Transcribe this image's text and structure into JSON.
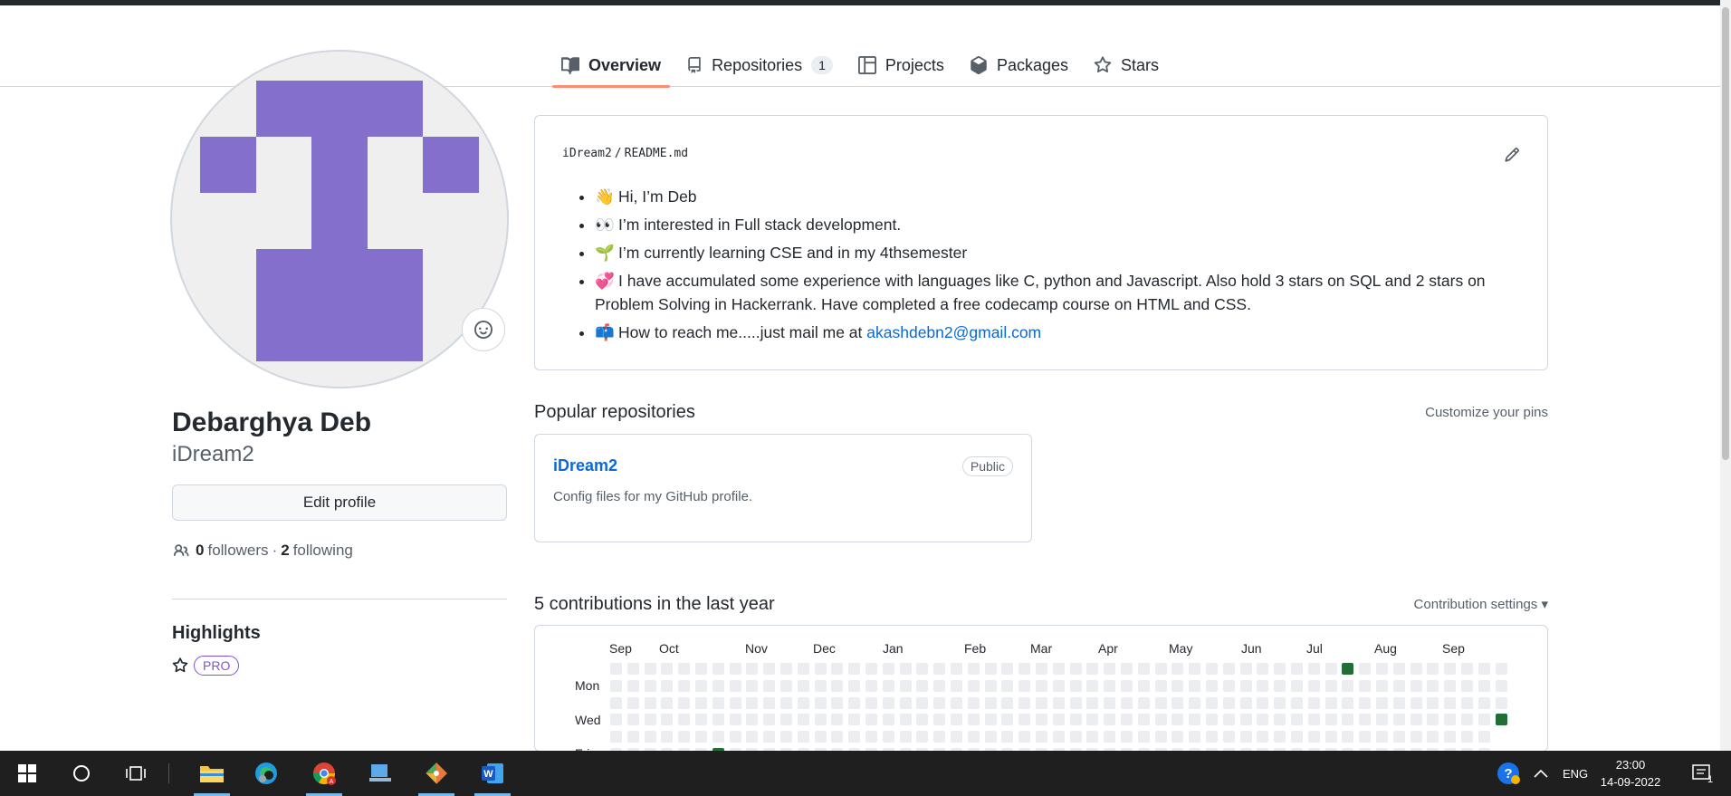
{
  "tabs": [
    {
      "label": "Overview",
      "icon": "book-icon"
    },
    {
      "label": "Repositories",
      "icon": "repo-icon",
      "count": "1"
    },
    {
      "label": "Projects",
      "icon": "table-icon"
    },
    {
      "label": "Packages",
      "icon": "package-icon"
    },
    {
      "label": "Stars",
      "icon": "star-icon"
    }
  ],
  "profile": {
    "name": "Debarghya Deb",
    "login": "iDream2",
    "edit_label": "Edit profile",
    "followers_count": "0",
    "followers_label": "followers",
    "separator": "·",
    "following_count": "2",
    "following_label": "following",
    "highlights_title": "Highlights",
    "pro_badge": "PRO"
  },
  "readme": {
    "owner": "iDream2",
    "slash": "/",
    "file": "README.md",
    "items": [
      {
        "emoji": "👋",
        "text": "Hi, I’m Deb"
      },
      {
        "emoji": "👀",
        "text": "I’m interested in Full stack development."
      },
      {
        "emoji": "🌱",
        "text": "I’m currently learning CSE and in my 4thsemester"
      },
      {
        "emoji": "💞️",
        "text": "I have accumulated some experience with languages like C, python and Javascript. Also hold 3 stars on SQL and 2 stars on Problem Solving in Hackerrank. Have completed a free codecamp course on HTML and CSS."
      },
      {
        "emoji": "📫",
        "text": "How to reach me.....just mail me at ",
        "link": "akashdebn2@gmail.com"
      }
    ]
  },
  "popular": {
    "title": "Popular repositories",
    "customize": "Customize your pins",
    "repo": {
      "name": "iDream2",
      "visibility": "Public",
      "description": "Config files for my GitHub profile."
    }
  },
  "contributions": {
    "title": "5 contributions in the last year",
    "settings": "Contribution settings ▾",
    "months": [
      "Sep",
      "Oct",
      "Nov",
      "Dec",
      "Jan",
      "Feb",
      "Mar",
      "Apr",
      "May",
      "Jun",
      "Jul",
      "Aug",
      "Sep"
    ],
    "days": [
      "Mon",
      "Wed",
      "Fri"
    ],
    "visible_active_days": [
      {
        "week": 43,
        "day": 0
      },
      {
        "week": 52,
        "day": 3
      },
      {
        "week": 6,
        "day": 5
      }
    ]
  },
  "taskbar": {
    "apps": [
      "start-icon",
      "search-icon",
      "task-view-icon",
      "file-explorer-icon",
      "edge-icon",
      "chrome-icon",
      "desktop-app-icon",
      "git-icon",
      "word-icon"
    ],
    "lang": "ENG",
    "time": "23:00",
    "date": "14-09-2022",
    "notifications": "1"
  },
  "colors": {
    "accent_tab": "#fd8c73",
    "link": "#0969da",
    "avatar": "#8470cc",
    "contrib_active": "#216e39",
    "contrib_empty": "#ebedf0"
  }
}
